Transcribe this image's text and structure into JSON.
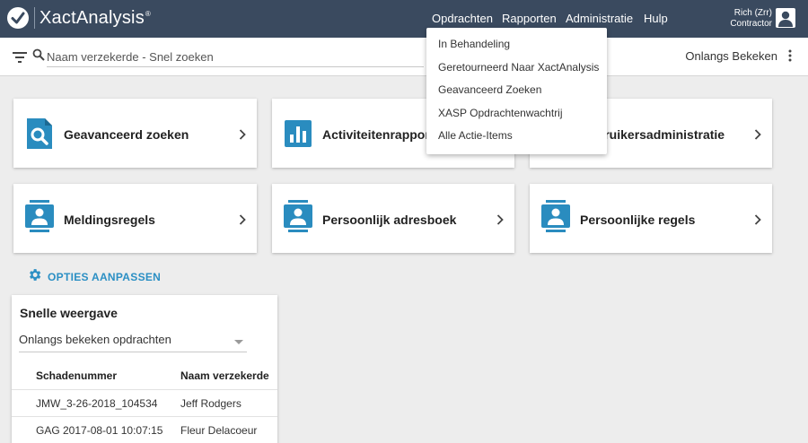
{
  "header": {
    "logo_text": "XactAnalysis",
    "logo_mark": "®",
    "nav": [
      "Opdrachten",
      "Rapporten",
      "Administratie",
      "Hulp"
    ],
    "user_name": "Rich (Zrr)",
    "user_role": "Contractor"
  },
  "search": {
    "placeholder": "Naam verzekerde - Snel zoeken",
    "recent_label": "Onlangs Bekeken"
  },
  "dropdown": {
    "items": [
      "In Behandeling",
      "Geretourneerd Naar XactAnalysis",
      "Geavanceerd Zoeken",
      "XASP Opdrachtenwachtrij",
      "Alle Actie-Items"
    ]
  },
  "tiles": [
    {
      "label": "Geavanceerd zoeken",
      "icon": "search-document-icon"
    },
    {
      "label": "Activiteitenrapporten",
      "icon": "bar-chart-icon"
    },
    {
      "label": "Gebruikersadministratie",
      "icon": "user-admin-icon"
    },
    {
      "label": "Meldingsregels",
      "icon": "person-card-icon"
    },
    {
      "label": "Persoonlijk adresboek",
      "icon": "person-card-icon"
    },
    {
      "label": "Persoonlijke regels",
      "icon": "person-card-icon"
    }
  ],
  "options": {
    "label": "OPTIES AANPASSEN",
    "icon": "gear-icon"
  },
  "quick_view": {
    "title": "Snelle weergave",
    "selected": "Onlangs bekeken opdrachten",
    "columns": [
      "Schadenummer",
      "Naam verzekerde"
    ],
    "rows": [
      [
        "JMW_3-26-2018_104534",
        "Jeff Rodgers"
      ],
      [
        "GAG 2017-08-01 10:07:15",
        "Fleur Delacoeur"
      ]
    ]
  },
  "colors": {
    "header_bg": "#3a4a5f",
    "accent": "#2b8fc4",
    "background": "#ededed"
  }
}
